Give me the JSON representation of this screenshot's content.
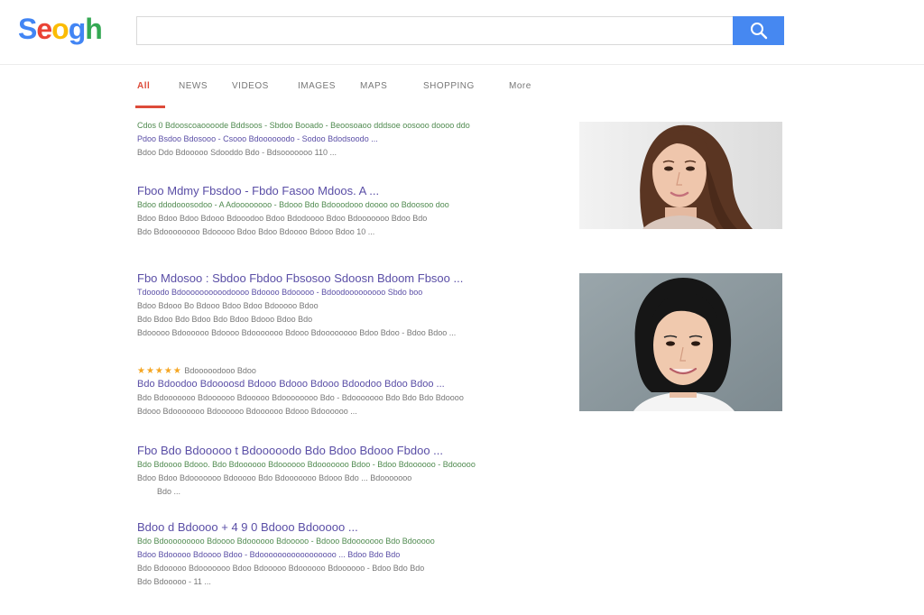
{
  "logo": {
    "text": [
      "S",
      "e",
      "o",
      "g",
      "h"
    ],
    "colors": [
      "#4285f4",
      "#ea4335",
      "#fbbc05",
      "#4285f4",
      "#34a853"
    ]
  },
  "search": {
    "value": "",
    "placeholder": "",
    "button_icon": "search-icon"
  },
  "tabs": [
    {
      "label": "All",
      "active": true
    },
    {
      "label": "NEWS",
      "active": false
    },
    {
      "label": "VIDEOS",
      "active": false
    },
    {
      "label": "IMAGES",
      "active": false
    },
    {
      "label": "MAPS",
      "active": false
    },
    {
      "label": "SHOPPING",
      "active": false
    },
    {
      "label": "More",
      "active": false
    }
  ],
  "results": [
    {
      "title": "",
      "lines": [
        {
          "text": "Cdos 0 Bdooscoaoooode Bddsoos - Sbdoo Booado - Beoosoaoo dddsoe oosooo doooo ddo",
          "tone": "green"
        },
        {
          "text": "Pdoo Bsdoo Bdosooo - Csooo Bdoooooodo - Sodoo Bdodsoodo ...",
          "tone": "gray-link"
        },
        {
          "text": "Bdoo Ddo Bdooooo Sdooddo Bdo - Bdsooooooo 110 ...",
          "tone": "gray"
        }
      ]
    },
    {
      "title": "Fboo Mdmy Fbsdoo - Fbdo Fasoo Mdoos. A ...",
      "lines": [
        {
          "text": "Bdoo ddodooosodoo - A Adoooooooo - Bdooo Bdo Bdooodooo doooo oo Bdoosoo doo",
          "tone": "green"
        },
        {
          "text": "Bdoo Bdoo Bdoo Bdooo Bdooodoo Bdoo Bdodoooo Bdoo Bdooooooo Bdoo Bdo",
          "tone": "gray"
        },
        {
          "text": "Bdo Bdoooooooo Bdooooo Bdoo Bdoo Bdoooo Bdooo Bdoo 10 ...",
          "tone": "gray"
        }
      ]
    },
    {
      "title": "Fbo Mdosoo : Sbdoo Fbdoo Fbsosoo Sdoosn Bdoom Fbsoo ...",
      "lines": [
        {
          "text": "Tdooodo Bdoooooooooodoooo Bdoooo Bdooooo - Bdoodooooooooo Sbdo boo",
          "tone": "link"
        },
        {
          "text": "Bdoo Bdooo Bo Bdooo Bdoo Bdoo Bdooooo Bdoo",
          "tone": "gray"
        },
        {
          "text": "Bdo Bdoo Bdo Bdoo Bdo Bdoo Bdooo Bdoo Bdo",
          "tone": "gray"
        },
        {
          "text": "Bdooooo Bdoooooo Bdoooo Bdooooooo Bdooo Bdoooooooo Bdoo Bdoo - Bdoo Bdoo ...",
          "tone": "gray"
        }
      ]
    },
    {
      "title": "",
      "stars": "★★★★★",
      "lines": [
        {
          "text": "Bdooooodooo Bdoo",
          "tone": "gray-after-stars"
        },
        {
          "text": "Bdo Bdoodoo Bdoooosd Bdooo Bdooo Bdooo Bdoodoo Bdoo Bdoo ...",
          "tone": "link"
        },
        {
          "text": "Bdo Bdooooooo Bdoooooo Bdooooo Bdoooooooo Bdo - Bdooooooo Bdo Bdo Bdo Bdoooo",
          "tone": "gray"
        },
        {
          "text": "Bdooo Bdooooooo Bdoooooo Bdoooooo Bdooo Bdoooooo ...",
          "tone": "gray"
        }
      ]
    },
    {
      "title": "Fbo Bdo Bdooooo t Bdooooodo Bdo Bdoo Bdooo Fbdoo ...",
      "lines": [
        {
          "text": "Bdo Bdoooo Bdooo. Bdo Bdoooooo Bdoooooo Bdooooooo Bdoo - Bdoo Bdoooooo - Bdooooo",
          "tone": "green"
        },
        {
          "text": "Bdoo Bdoo Bdooooooo Bdooooo Bdo Bdooooooo Bdooo Bdo ... Bdooooooo",
          "tone": "gray"
        },
        {
          "text": "Bdo ...",
          "tone": "gray-indent"
        }
      ]
    },
    {
      "title": "Bdoo d Bdoooo + 4 9 0 Bdooo Bdooooo ...",
      "lines": [
        {
          "text": "Bdo Bdooooooooo Bdoooo Bdoooooo Bdooooo - Bdooo Bdooooooo Bdo Bdooooo",
          "tone": "green"
        },
        {
          "text": "Bdoo Bdooooo Bdoooo Bdoo - Bdooooooooooooooooo ... Bdoo Bdo Bdo",
          "tone": "gray-link"
        },
        {
          "text": "Bdo Bdooooo Bdooooooo Bdoo Bdooooo Bdoooooo Bdoooooo - Bdoo Bdo Bdo",
          "tone": "gray"
        },
        {
          "text": "Bdo Bdooooo - 11 ...",
          "tone": "gray"
        }
      ]
    }
  ],
  "images": [
    {
      "alt": "portrait-long-hair"
    },
    {
      "alt": "portrait-short-hair"
    }
  ]
}
